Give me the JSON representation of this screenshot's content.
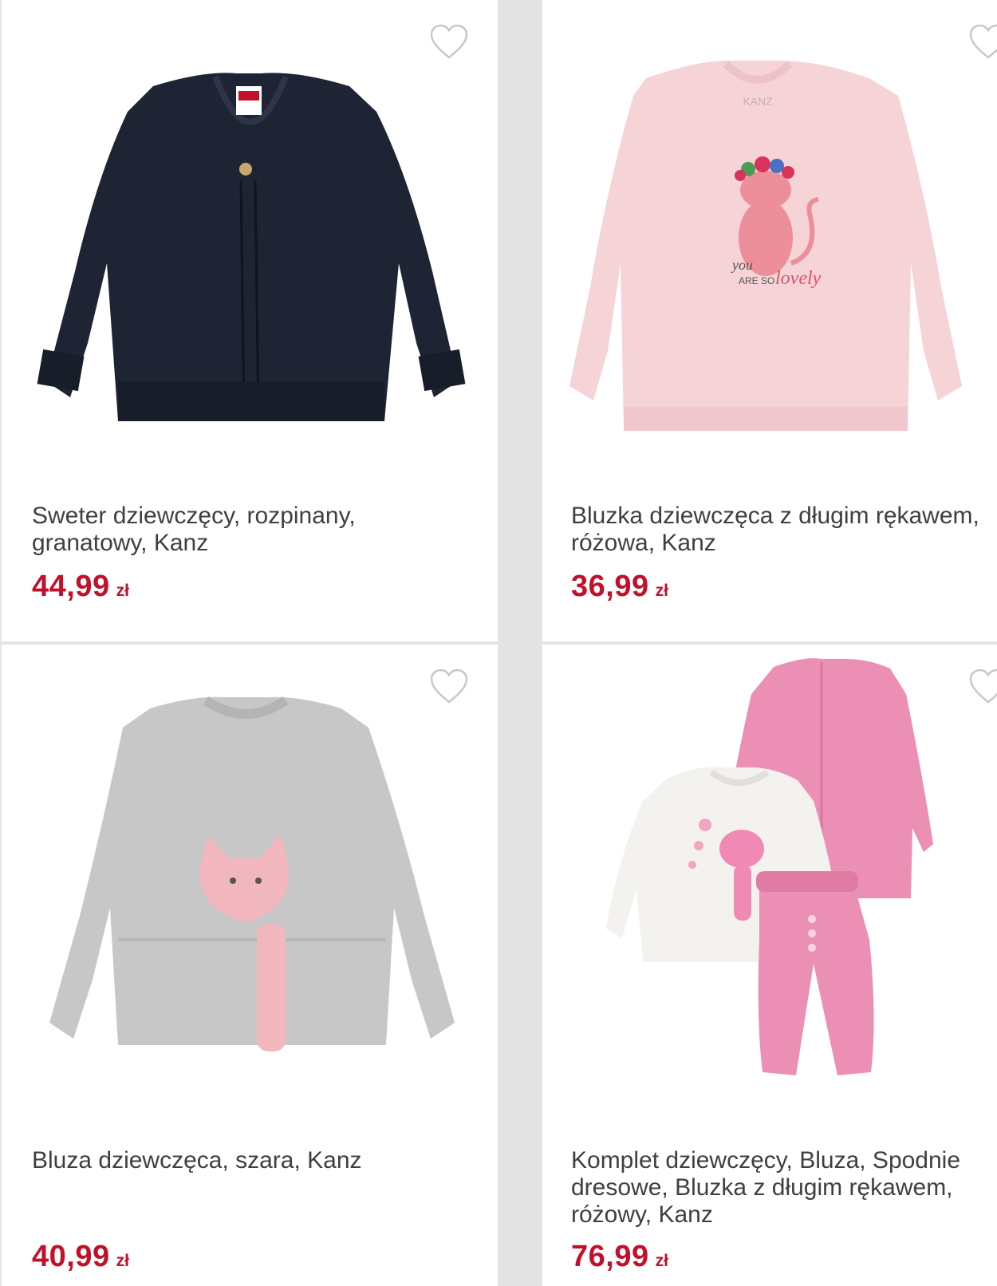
{
  "colors": {
    "price": "#c3102a",
    "title": "#3f3f3f",
    "background": "#e4e4e4",
    "card": "#ffffff"
  },
  "products": [
    {
      "title": "Sweter dziewczęcy, rozpinany, granatowy, Kanz",
      "price": "44,99",
      "currency": "zł",
      "image": "navy-cardigan",
      "favorite_icon": "heart-outline-icon"
    },
    {
      "title": "Bluzka dziewczęca z długim rękawem, różowa, Kanz",
      "price": "36,99",
      "currency": "zł",
      "image": "pink-longsleeve-cat-top",
      "favorite_icon": "heart-outline-icon",
      "image_text": {
        "brand_tag": "KANZ",
        "print_line1": "you",
        "print_line2": "ARE SO",
        "print_line3": "lovely"
      }
    },
    {
      "title": "Bluza dziewczęca, szara, Kanz",
      "price": "40,99",
      "currency": "zł",
      "image": "grey-sweatshirt-cat",
      "favorite_icon": "heart-outline-icon"
    },
    {
      "title": "Komplet dziewczęcy, Bluza, Spodnie dresowe, Bluzka z długim rękawem, różowy, Kanz",
      "price": "76,99",
      "currency": "zł",
      "image": "pink-three-piece-set",
      "favorite_icon": "heart-outline-icon"
    }
  ]
}
